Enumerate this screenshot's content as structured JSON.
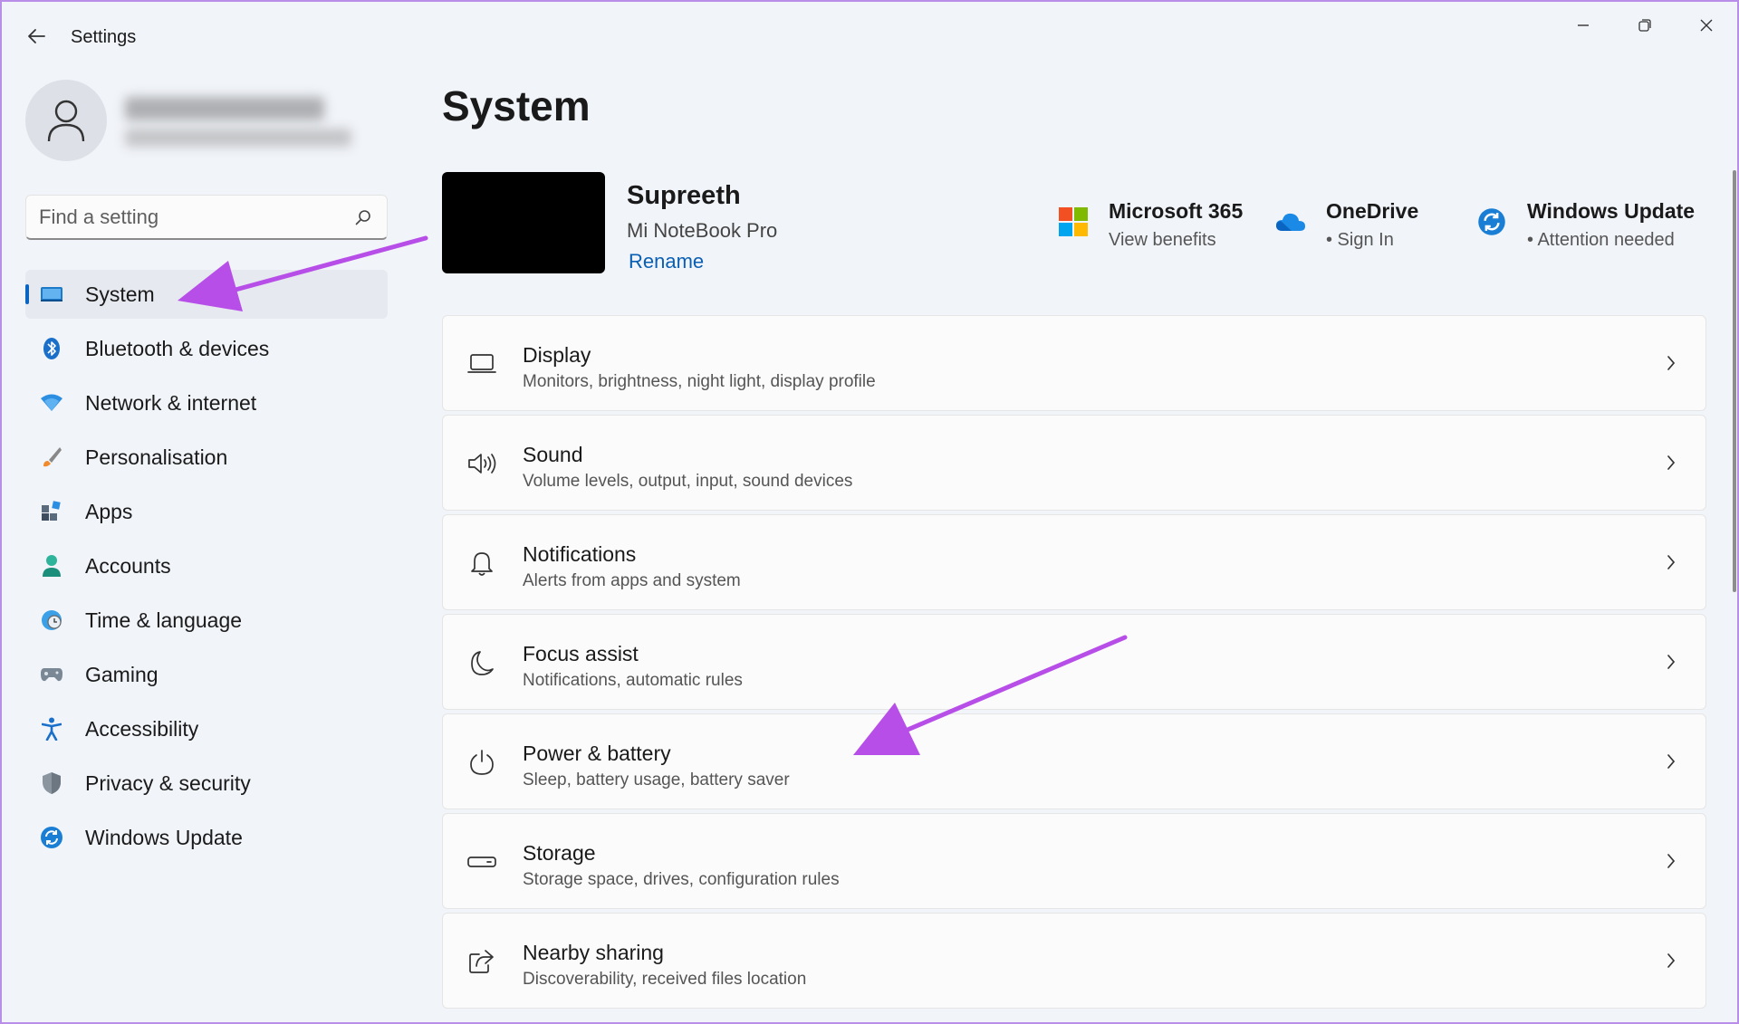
{
  "window": {
    "title": "Settings"
  },
  "search": {
    "placeholder": "Find a setting",
    "value": ""
  },
  "sidebar": {
    "items": [
      {
        "label": "System",
        "icon": "system-icon",
        "active": true
      },
      {
        "label": "Bluetooth & devices",
        "icon": "bluetooth-icon"
      },
      {
        "label": "Network & internet",
        "icon": "wifi-icon"
      },
      {
        "label": "Personalisation",
        "icon": "brush-icon"
      },
      {
        "label": "Apps",
        "icon": "apps-icon"
      },
      {
        "label": "Accounts",
        "icon": "account-icon"
      },
      {
        "label": "Time & language",
        "icon": "globe-clock-icon"
      },
      {
        "label": "Gaming",
        "icon": "gamepad-icon"
      },
      {
        "label": "Accessibility",
        "icon": "accessibility-icon"
      },
      {
        "label": "Privacy & security",
        "icon": "shield-icon"
      },
      {
        "label": "Windows Update",
        "icon": "update-icon"
      }
    ]
  },
  "main": {
    "title": "System",
    "device": {
      "name": "Supreeth",
      "model": "Mi NoteBook Pro",
      "rename": "Rename"
    },
    "quick_links": [
      {
        "title": "Microsoft 365",
        "subtitle": "View benefits",
        "icon": "microsoft-logo-icon"
      },
      {
        "title": "OneDrive",
        "subtitle": "• Sign In",
        "icon": "cloud-icon"
      },
      {
        "title": "Windows Update",
        "subtitle": "• Attention needed",
        "icon": "update-icon"
      }
    ],
    "cards": [
      {
        "title": "Display",
        "subtitle": "Monitors, brightness, night light, display profile",
        "icon": "monitor-icon"
      },
      {
        "title": "Sound",
        "subtitle": "Volume levels, output, input, sound devices",
        "icon": "speaker-icon"
      },
      {
        "title": "Notifications",
        "subtitle": "Alerts from apps and system",
        "icon": "bell-icon"
      },
      {
        "title": "Focus assist",
        "subtitle": "Notifications, automatic rules",
        "icon": "moon-icon"
      },
      {
        "title": "Power & battery",
        "subtitle": "Sleep, battery usage, battery saver",
        "icon": "power-icon"
      },
      {
        "title": "Storage",
        "subtitle": "Storage space, drives, configuration rules",
        "icon": "storage-icon"
      },
      {
        "title": "Nearby sharing",
        "subtitle": "Discoverability, received files location",
        "icon": "share-icon"
      }
    ]
  },
  "colors": {
    "accent": "#0a64c2",
    "annotation": "#b74ee8",
    "window_border": "#b98ee8"
  }
}
